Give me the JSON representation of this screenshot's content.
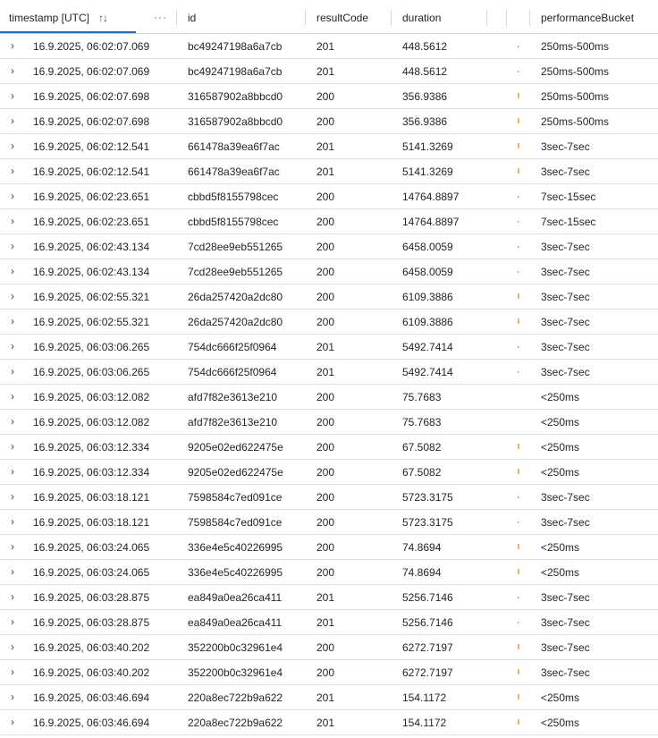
{
  "columns": {
    "timestamp": "timestamp [UTC]",
    "id": "id",
    "resultCode": "resultCode",
    "duration": "duration",
    "performanceBucket": "performanceBucket"
  },
  "icons": {
    "sort": "↑↓",
    "more": "···",
    "expand": "›"
  },
  "colors": {
    "accent": "#0f6cbd",
    "tick_orange": "#f0b35a",
    "tick_gray": "#8a8a8a"
  },
  "rows": [
    {
      "timestamp": "16.9.2025, 06:02:07.069",
      "id": "bc49247198a6a7cb",
      "resultCode": "201",
      "duration": "448.5612",
      "performanceBucket": "250ms-500ms",
      "tick": "gray"
    },
    {
      "timestamp": "16.9.2025, 06:02:07.069",
      "id": "bc49247198a6a7cb",
      "resultCode": "201",
      "duration": "448.5612",
      "performanceBucket": "250ms-500ms",
      "tick": "gray"
    },
    {
      "timestamp": "16.9.2025, 06:02:07.698",
      "id": "316587902a8bbcd0",
      "resultCode": "200",
      "duration": "356.9386",
      "performanceBucket": "250ms-500ms",
      "tick": "orange"
    },
    {
      "timestamp": "16.9.2025, 06:02:07.698",
      "id": "316587902a8bbcd0",
      "resultCode": "200",
      "duration": "356.9386",
      "performanceBucket": "250ms-500ms",
      "tick": "orange"
    },
    {
      "timestamp": "16.9.2025, 06:02:12.541",
      "id": "661478a39ea6f7ac",
      "resultCode": "201",
      "duration": "5141.3269",
      "performanceBucket": "3sec-7sec",
      "tick": "orange"
    },
    {
      "timestamp": "16.9.2025, 06:02:12.541",
      "id": "661478a39ea6f7ac",
      "resultCode": "201",
      "duration": "5141.3269",
      "performanceBucket": "3sec-7sec",
      "tick": "orange"
    },
    {
      "timestamp": "16.9.2025, 06:02:23.651",
      "id": "cbbd5f8155798cec",
      "resultCode": "200",
      "duration": "14764.8897",
      "performanceBucket": "7sec-15sec",
      "tick": "gray"
    },
    {
      "timestamp": "16.9.2025, 06:02:23.651",
      "id": "cbbd5f8155798cec",
      "resultCode": "200",
      "duration": "14764.8897",
      "performanceBucket": "7sec-15sec",
      "tick": "gray"
    },
    {
      "timestamp": "16.9.2025, 06:02:43.134",
      "id": "7cd28ee9eb551265",
      "resultCode": "200",
      "duration": "6458.0059",
      "performanceBucket": "3sec-7sec",
      "tick": "gray"
    },
    {
      "timestamp": "16.9.2025, 06:02:43.134",
      "id": "7cd28ee9eb551265",
      "resultCode": "200",
      "duration": "6458.0059",
      "performanceBucket": "3sec-7sec",
      "tick": "gray"
    },
    {
      "timestamp": "16.9.2025, 06:02:55.321",
      "id": "26da257420a2dc80",
      "resultCode": "200",
      "duration": "6109.3886",
      "performanceBucket": "3sec-7sec",
      "tick": "orange"
    },
    {
      "timestamp": "16.9.2025, 06:02:55.321",
      "id": "26da257420a2dc80",
      "resultCode": "200",
      "duration": "6109.3886",
      "performanceBucket": "3sec-7sec",
      "tick": "orange"
    },
    {
      "timestamp": "16.9.2025, 06:03:06.265",
      "id": "754dc666f25f0964",
      "resultCode": "201",
      "duration": "5492.7414",
      "performanceBucket": "3sec-7sec",
      "tick": "gray"
    },
    {
      "timestamp": "16.9.2025, 06:03:06.265",
      "id": "754dc666f25f0964",
      "resultCode": "201",
      "duration": "5492.7414",
      "performanceBucket": "3sec-7sec",
      "tick": "gray"
    },
    {
      "timestamp": "16.9.2025, 06:03:12.082",
      "id": "afd7f82e3613e210",
      "resultCode": "200",
      "duration": "75.7683",
      "performanceBucket": "<250ms",
      "tick": "none"
    },
    {
      "timestamp": "16.9.2025, 06:03:12.082",
      "id": "afd7f82e3613e210",
      "resultCode": "200",
      "duration": "75.7683",
      "performanceBucket": "<250ms",
      "tick": "none"
    },
    {
      "timestamp": "16.9.2025, 06:03:12.334",
      "id": "9205e02ed622475e",
      "resultCode": "200",
      "duration": "67.5082",
      "performanceBucket": "<250ms",
      "tick": "orange"
    },
    {
      "timestamp": "16.9.2025, 06:03:12.334",
      "id": "9205e02ed622475e",
      "resultCode": "200",
      "duration": "67.5082",
      "performanceBucket": "<250ms",
      "tick": "orange"
    },
    {
      "timestamp": "16.9.2025, 06:03:18.121",
      "id": "7598584c7ed091ce",
      "resultCode": "200",
      "duration": "5723.3175",
      "performanceBucket": "3sec-7sec",
      "tick": "gray"
    },
    {
      "timestamp": "16.9.2025, 06:03:18.121",
      "id": "7598584c7ed091ce",
      "resultCode": "200",
      "duration": "5723.3175",
      "performanceBucket": "3sec-7sec",
      "tick": "gray"
    },
    {
      "timestamp": "16.9.2025, 06:03:24.065",
      "id": "336e4e5c40226995",
      "resultCode": "200",
      "duration": "74.8694",
      "performanceBucket": "<250ms",
      "tick": "orange"
    },
    {
      "timestamp": "16.9.2025, 06:03:24.065",
      "id": "336e4e5c40226995",
      "resultCode": "200",
      "duration": "74.8694",
      "performanceBucket": "<250ms",
      "tick": "orange"
    },
    {
      "timestamp": "16.9.2025, 06:03:28.875",
      "id": "ea849a0ea26ca411",
      "resultCode": "201",
      "duration": "5256.7146",
      "performanceBucket": "3sec-7sec",
      "tick": "gray"
    },
    {
      "timestamp": "16.9.2025, 06:03:28.875",
      "id": "ea849a0ea26ca411",
      "resultCode": "201",
      "duration": "5256.7146",
      "performanceBucket": "3sec-7sec",
      "tick": "gray"
    },
    {
      "timestamp": "16.9.2025, 06:03:40.202",
      "id": "352200b0c32961e4",
      "resultCode": "200",
      "duration": "6272.7197",
      "performanceBucket": "3sec-7sec",
      "tick": "orange"
    },
    {
      "timestamp": "16.9.2025, 06:03:40.202",
      "id": "352200b0c32961e4",
      "resultCode": "200",
      "duration": "6272.7197",
      "performanceBucket": "3sec-7sec",
      "tick": "orange"
    },
    {
      "timestamp": "16.9.2025, 06:03:46.694",
      "id": "220a8ec722b9a622",
      "resultCode": "201",
      "duration": "154.1172",
      "performanceBucket": "<250ms",
      "tick": "orange"
    },
    {
      "timestamp": "16.9.2025, 06:03:46.694",
      "id": "220a8ec722b9a622",
      "resultCode": "201",
      "duration": "154.1172",
      "performanceBucket": "<250ms",
      "tick": "orange"
    }
  ]
}
